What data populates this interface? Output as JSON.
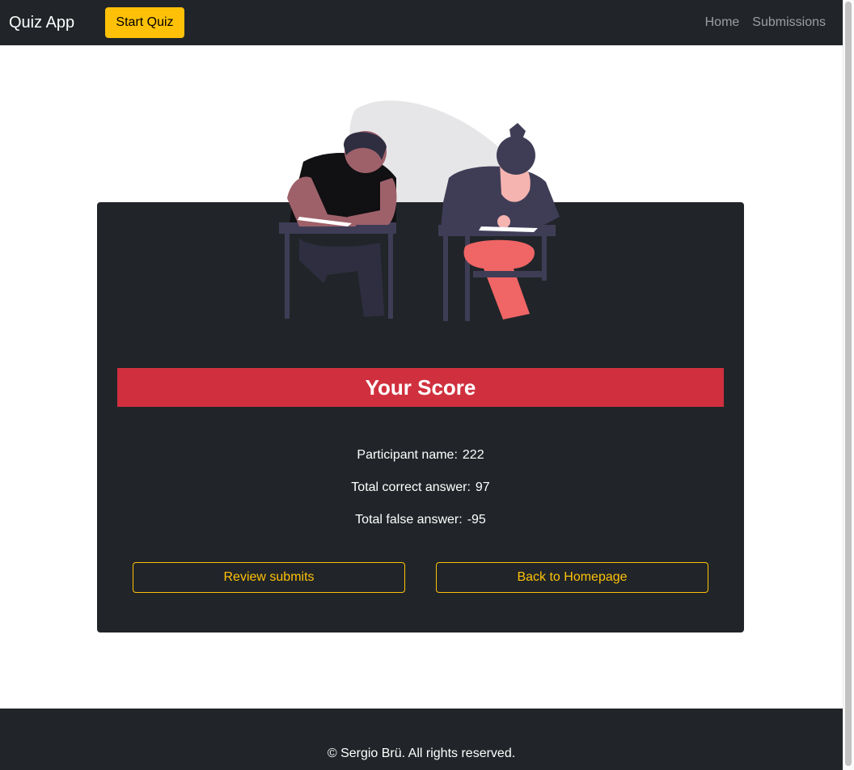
{
  "navbar": {
    "brand": "Quiz App",
    "start_quiz_label": "Start Quiz",
    "links": [
      {
        "label": "Home"
      },
      {
        "label": "Submissions"
      }
    ]
  },
  "score_card": {
    "title": "Your Score",
    "participant_label": "Participant name:",
    "participant_value": "222",
    "correct_label": "Total correct answer:",
    "correct_value": "97",
    "false_label": "Total false answer:",
    "false_value": "-95",
    "review_button": "Review submits",
    "back_button": "Back to Homepage"
  },
  "footer": {
    "text": "© Sergio Brü. All rights reserved."
  },
  "colors": {
    "dark": "#212529",
    "warning": "#ffc107",
    "danger": "#d0303e"
  },
  "icons": {
    "illustration": "students-taking-exam-illustration"
  }
}
